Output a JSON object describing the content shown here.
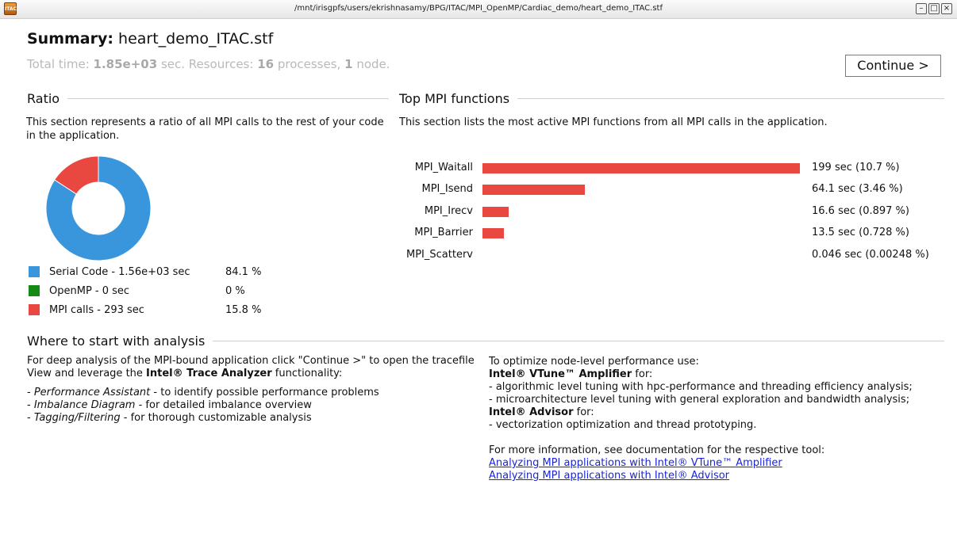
{
  "window": {
    "title": "/mnt/irisgpfs/users/ekrishnasamy/BPG/ITAC/MPI_OpenMP/Cardiac_demo/heart_demo_ITAC.stf",
    "app_icon_text": "ITAC",
    "minimize_glyph": "–",
    "maximize_glyph": "□",
    "close_glyph": "×"
  },
  "summary": {
    "label": "Summary:",
    "filename": "heart_demo_ITAC.stf",
    "total_time_label": "Total time:",
    "total_time_value": "1.85e+03",
    "total_time_unit": "sec. Resources:",
    "processes_value": "16",
    "processes_label": "processes,",
    "nodes_value": "1",
    "nodes_label": "node."
  },
  "continue_label": "Continue >",
  "ratio": {
    "heading": "Ratio",
    "description": "This section represents a ratio of all MPI calls to the rest of your code in the application.",
    "items": [
      {
        "label": "Serial Code - 1.56e+03 sec",
        "percent": "84.1 %",
        "value": 84.1,
        "color": "#3a96dc"
      },
      {
        "label": "OpenMP - 0 sec",
        "percent": "0 %",
        "value": 0,
        "color": "#128a14"
      },
      {
        "label": "MPI calls - 293 sec",
        "percent": "15.8 %",
        "value": 15.8,
        "color": "#e8483f"
      }
    ]
  },
  "top_mpi": {
    "heading": "Top MPI functions",
    "description": "This section lists the most active MPI functions from all MPI calls in the application.",
    "bar_color": "#e8483f",
    "functions": [
      {
        "name": "MPI_Waitall",
        "seconds": 199,
        "value_text": "199 sec (10.7 %)"
      },
      {
        "name": "MPI_Isend",
        "seconds": 64.1,
        "value_text": "64.1 sec (3.46 %)"
      },
      {
        "name": "MPI_Irecv",
        "seconds": 16.6,
        "value_text": "16.6 sec (0.897 %)"
      },
      {
        "name": "MPI_Barrier",
        "seconds": 13.5,
        "value_text": "13.5 sec (0.728 %)"
      },
      {
        "name": "MPI_Scatterv",
        "seconds": 0.046,
        "value_text": "0.046 sec (0.00248 %)"
      }
    ]
  },
  "analysis": {
    "heading": "Where to start with analysis",
    "left_intro_1": "For deep analysis of the MPI-bound application click \"Continue >\" to open the tracefile View and leverage the ",
    "left_intro_bold": "Intel® Trace Analyzer",
    "left_intro_2": " functionality:",
    "tools": [
      {
        "name": "Performance Assistant",
        "desc": " - to identify possible performance problems"
      },
      {
        "name": "Imbalance Diagram",
        "desc": " - for detailed imbalance overview"
      },
      {
        "name": "Tagging/Filtering",
        "desc": " - for thorough customizable analysis"
      }
    ],
    "dash": "- ",
    "right_intro": "To optimize node-level performance use:",
    "vtune_name": "Intel® VTune™ Amplifier",
    "for_label": " for:",
    "vtune_line1": "- algorithmic level tuning with hpc-performance and threading efficiency analysis;",
    "vtune_line2": "- microarchitecture level tuning with general exploration and bandwidth analysis;",
    "advisor_name": "Intel® Advisor",
    "advisor_line1": "- vectorization optimization and thread prototyping.",
    "more_info": "For more information, see documentation for the respective tool:",
    "link_vtune": "Analyzing MPI applications with Intel® VTune™ Amplifier",
    "link_advisor": "Analyzing MPI applications with Intel® Advisor"
  }
}
